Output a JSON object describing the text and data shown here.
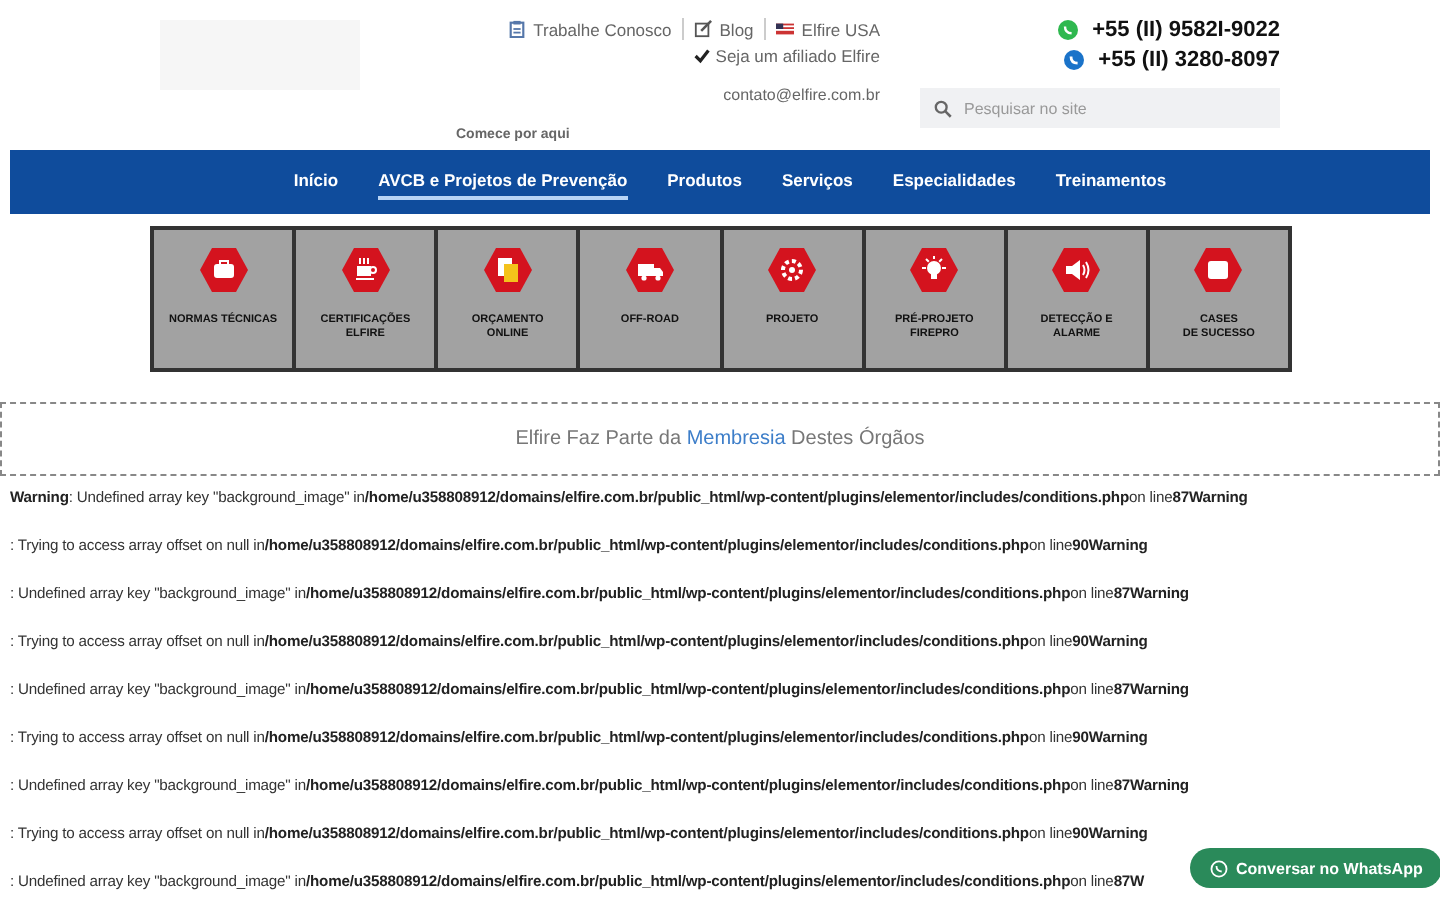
{
  "header": {
    "top_links": [
      {
        "kind": "clipboard",
        "label": "Trabalhe Conosco"
      },
      {
        "kind": "edit",
        "label": "Blog"
      },
      {
        "kind": "flag",
        "label": "Elfire USA"
      }
    ],
    "affiliate": "Seja um afiliado Elfire",
    "email": "contato@elfire.com.br",
    "phones": [
      {
        "kind": "whatsapp",
        "number": "+55 (II) 9582I-9022"
      },
      {
        "kind": "phone",
        "number": "+55 (II) 3280-8097"
      }
    ],
    "search": {
      "placeholder": "Pesquisar no site"
    },
    "start_label": "Comece por aqui"
  },
  "nav": [
    {
      "label": "Início",
      "selected": false
    },
    {
      "label": "AVCB e Projetos de Prevenção",
      "selected": true
    },
    {
      "label": "Produtos",
      "selected": false
    },
    {
      "label": "Serviços",
      "selected": false
    },
    {
      "label": "Especialidades",
      "selected": false
    },
    {
      "label": "Treinamentos",
      "selected": false
    }
  ],
  "tiles": [
    {
      "label": "NORMAS TÉCNICAS"
    },
    {
      "label": "CERTIFICAÇÕES\nELFIRE"
    },
    {
      "label": "ORÇAMENTO\nONLINE"
    },
    {
      "label": "OFF-ROAD"
    },
    {
      "label": "PROJETO"
    },
    {
      "label": "PRÉ-PROJETO\nFIREPRO"
    },
    {
      "label": "DETECÇÃO E\nALARME"
    },
    {
      "label": "CASES\nDE SUCESSO"
    }
  ],
  "membership": {
    "before": "Elfire Faz Parte da ",
    "link": "Membresia",
    "after": " Destes Órgãos"
  },
  "warnings": [
    "**Warning**: Undefined array key \"background_image\" in**/home/u358808912/domains/elfire.com.br/public_html/wp-content/plugins/elementor/includes/conditions.php**on line**87Warning**",
    ": Trying to access array offset on null in**/home/u358808912/domains/elfire.com.br/public_html/wp-content/plugins/elementor/includes/conditions.php**on line**90Warning**",
    ": Undefined array key \"background_image\" in**/home/u358808912/domains/elfire.com.br/public_html/wp-content/plugins/elementor/includes/conditions.php**on line**87Warning**",
    ": Trying to access array offset on null in**/home/u358808912/domains/elfire.com.br/public_html/wp-content/plugins/elementor/includes/conditions.php**on line**90Warning**",
    ": Undefined array key \"background_image\" in**/home/u358808912/domains/elfire.com.br/public_html/wp-content/plugins/elementor/includes/conditions.php**on line**87Warning**",
    ": Trying to access array offset on null in**/home/u358808912/domains/elfire.com.br/public_html/wp-content/plugins/elementor/includes/conditions.php**on line**90Warning**",
    ": Undefined array key \"background_image\" in**/home/u358808912/domains/elfire.com.br/public_html/wp-content/plugins/elementor/includes/conditions.php**on line**87Warning**",
    ": Trying to access array offset on null in**/home/u358808912/domains/elfire.com.br/public_html/wp-content/plugins/elementor/includes/conditions.php**on line**90Warning**",
    ": Undefined array key \"background_image\" in**/home/u358808912/domains/elfire.com.br/public_html/wp-content/plugins/elementor/includes/conditions.php**on line**87W**"
  ],
  "chat_button": "Conversar no WhatsApp"
}
